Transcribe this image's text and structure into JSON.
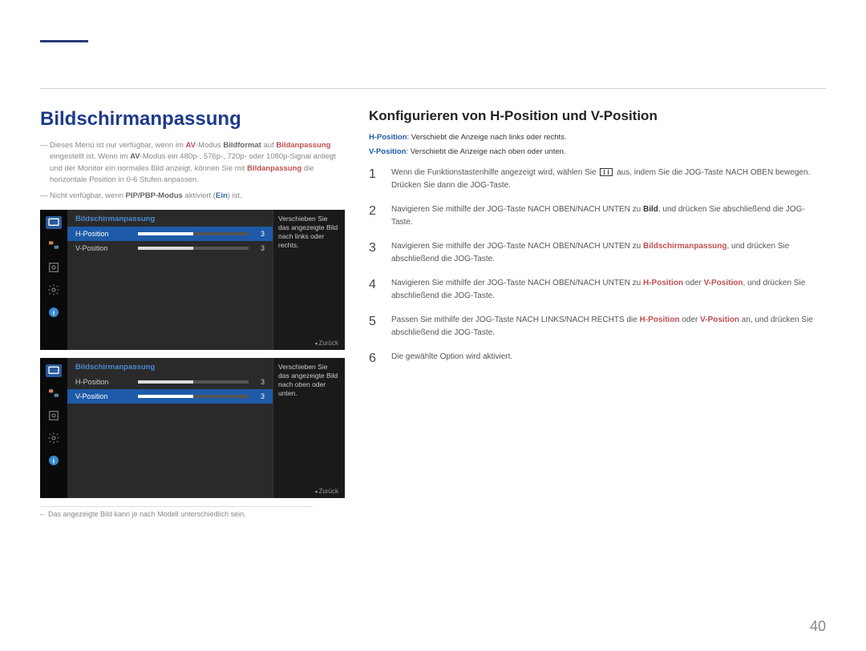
{
  "page_number": "40",
  "left": {
    "heading": "Bildschirmanpassung",
    "notes": [
      {
        "html": "Dieses Menü ist nur verfügbar, wenn im <b class='red'>AV</b>-Modus <b>Bildformat</b> auf <b class='red'>Bildanpassung</b> eingestellt ist. Wenn im <b>AV</b>-Modus ein 480p-, 576p-, 720p- oder 1080p-Signal anliegt und der Monitor ein normales Bild anzeigt, können Sie mit <b class='red'>Bildanpassung</b> die horizontale Position in 0-6 Stufen anpassen."
      },
      {
        "html": "Nicht verfügbar, wenn <b>PIP/PBP-Modus</b> aktiviert (<b class='blue'>Ein</b>) ist."
      }
    ],
    "osd1": {
      "title": "Bildschirmanpassung",
      "rows": [
        {
          "label": "H-Position",
          "value": "3",
          "selected": true
        },
        {
          "label": "V-Position",
          "value": "3",
          "selected": false
        }
      ],
      "help": "Verschieben Sie das angezeigte Bild nach links oder rechts.",
      "back": "Zurück"
    },
    "osd2": {
      "title": "Bildschirmanpassung",
      "rows": [
        {
          "label": "H-Position",
          "value": "3",
          "selected": false
        },
        {
          "label": "V-Position",
          "value": "3",
          "selected": true
        }
      ],
      "help": "Verschieben Sie das angezeigte Bild nach oben oder unten.",
      "back": "Zurück"
    },
    "footnote": "Das angezeigte Bild kann je nach Modell unterschiedlich sein."
  },
  "right": {
    "heading": "Konfigurieren von H-Position und V-Position",
    "defs": [
      {
        "html": "<span class='blue'>H-Position</span>: Verschiebt die Anzeige nach links oder rechts."
      },
      {
        "html": "<span class='blue'>V-Position</span>: Verschiebt die Anzeige nach oben oder unten."
      }
    ],
    "steps": [
      {
        "n": "1",
        "html": "Wenn die Funktionstastenhilfe angezeigt wird, wählen Sie <span class='inlinebox'></span> aus, indem Sie die JOG-Taste NACH OBEN bewegen. Drücken Sie dann die JOG-Taste."
      },
      {
        "n": "2",
        "html": "Navigieren Sie mithilfe der JOG-Taste NACH OBEN/NACH UNTEN zu <b>Bild</b>, und drücken Sie abschließend die JOG-Taste."
      },
      {
        "n": "3",
        "html": "Navigieren Sie mithilfe der JOG-Taste NACH OBEN/NACH UNTEN zu <b class='red'>Bildschirmanpassung</b>, und drücken Sie abschließend die JOG-Taste."
      },
      {
        "n": "4",
        "html": "Navigieren Sie mithilfe der JOG-Taste NACH OBEN/NACH UNTEN zu <b class='red'>H-Position</b> oder <b class='red'>V-Position</b>, und drücken Sie abschließend die JOG-Taste."
      },
      {
        "n": "5",
        "html": "Passen Sie mithilfe der JOG-Taste NACH LINKS/NACH RECHTS die <b class='red'>H-Position</b> oder <b class='red'>V-Position</b> an, und drücken Sie abschließend die JOG-Taste."
      },
      {
        "n": "6",
        "html": "Die gewählte Option wird aktiviert."
      }
    ]
  }
}
